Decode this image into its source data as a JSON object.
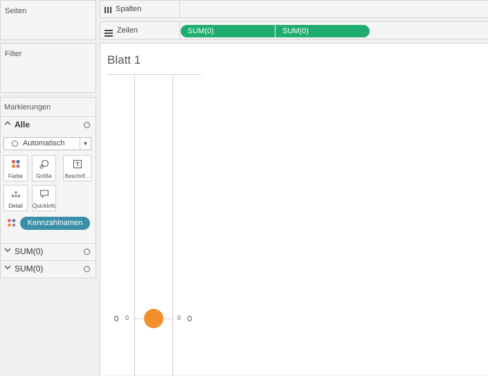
{
  "pages": {
    "title": "Seiten"
  },
  "filters": {
    "title": "Filter"
  },
  "marks": {
    "title": "Markierungen",
    "all_label": "Alle",
    "mark_type": "Automatisch",
    "tiles": [
      {
        "label": "Farbe",
        "icon": "color-dots-icon"
      },
      {
        "label": "Größe",
        "icon": "size-icon"
      },
      {
        "label": "Beschrif...",
        "icon": "text-label-icon"
      },
      {
        "label": "Detail",
        "icon": "detail-dots-icon"
      },
      {
        "label": "QuickInfo",
        "icon": "tooltip-icon"
      }
    ],
    "color_pill": "Kennzahlnamen",
    "measure_rows": [
      {
        "label": "SUM(0)"
      },
      {
        "label": "SUM(0)"
      }
    ]
  },
  "shelves": {
    "columns_label": "Spalten",
    "rows_label": "Zeilen",
    "row_pills": [
      "SUM(0)",
      "SUM(0)"
    ]
  },
  "sheet": {
    "title": "Blatt 1",
    "left_axis_tick": "0",
    "right_axis_tick": "0"
  },
  "colors": {
    "row_pill": "#1fad6f",
    "color_pill": "#3c8fa9",
    "mark": "#f28e2b"
  }
}
